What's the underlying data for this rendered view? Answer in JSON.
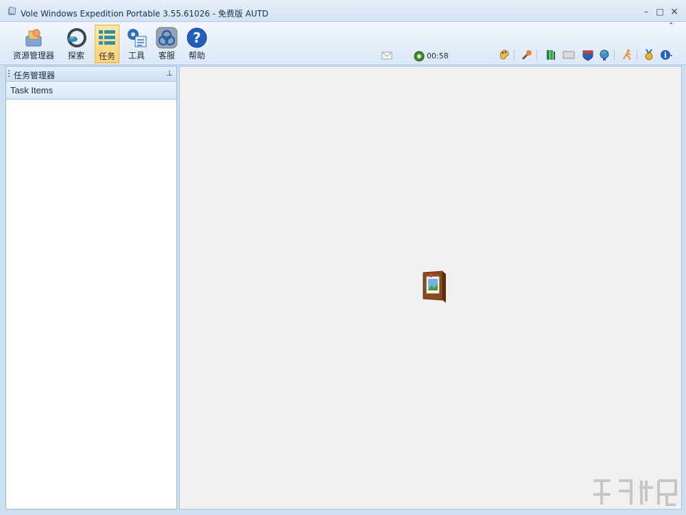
{
  "window": {
    "title": "Vole Windows Expedition Portable  3.55.61026 - 免费版 AUTD",
    "minimize": "–",
    "maximize": "□",
    "close": "×"
  },
  "ribbon": {
    "collapse_glyph": "⌃",
    "buttons": [
      {
        "label": "资源管理器",
        "icon": "explorer-icon"
      },
      {
        "label": "探索",
        "icon": "explore-icon"
      },
      {
        "label": "任务",
        "icon": "tasks-icon",
        "active": true
      },
      {
        "label": "工具",
        "icon": "tools-icon"
      },
      {
        "label": "客服",
        "icon": "support-icon"
      },
      {
        "label": "帮助",
        "icon": "help-icon"
      }
    ],
    "status": {
      "clock": "00:58"
    },
    "right_icons": [
      "palette-icon",
      "tools-bug-icon",
      "book-icon",
      "card-icon",
      "shield-badge-icon",
      "globe-icon",
      "runner-icon",
      "medal-icon",
      "info-icon"
    ]
  },
  "panel": {
    "title": "任务管理器",
    "pin_glyph": "⊥",
    "section": "Task Items"
  },
  "colors": {
    "active_button": "#ffd174",
    "frame": "#cfdff2",
    "main_bg": "#f0f0f0"
  }
}
